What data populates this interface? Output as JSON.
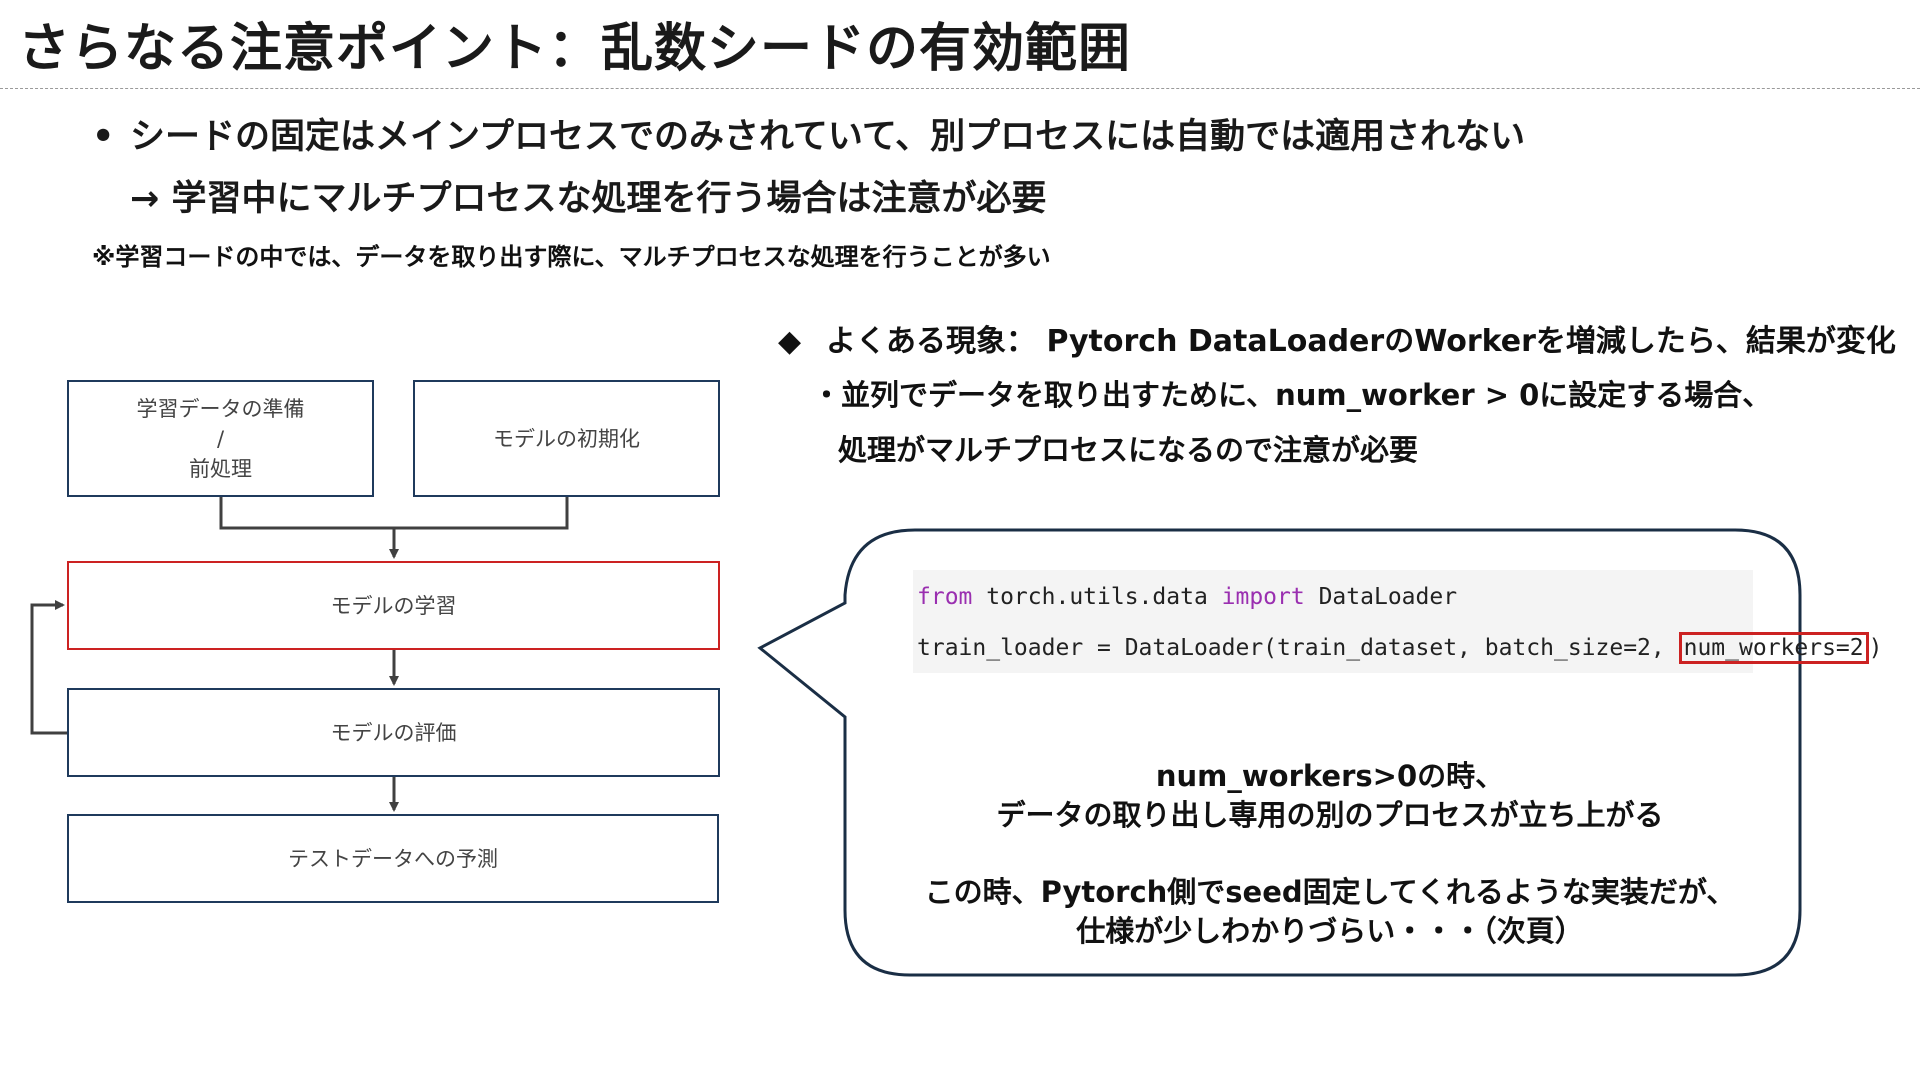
{
  "slide": {
    "title": "さらなる注意ポイント：乱数シードの有効範囲",
    "bullet_marker": "•",
    "bullet_text": "シードの固定はメインプロセスでのみされていて、別プロセスには自動では適用されない",
    "bullet_sub": "→ 学習中にマルチプロセスな処理を行う場合は注意が必要",
    "note": "※学習コードの中では、データを取り出す際に、マルチプロセスな処理を行うことが多い"
  },
  "flowchart": {
    "prep_line1": "学習データの準備",
    "prep_line2": "/",
    "prep_line3": "前処理",
    "init": "モデルの初期化",
    "train": "モデルの学習",
    "eval": "モデルの評価",
    "predict": "テストデータへの予測"
  },
  "right": {
    "diamond": "◆",
    "phenomenon": "よくある現象： Pytorch DataLoaderのWorkerを増減したら、結果が変化",
    "detail_line1": "・並列でデータを取り出すために、num_worker > 0に設定する場合、",
    "detail_line2": "処理がマルチプロセスになるので注意が必要"
  },
  "code": {
    "l1_from": "from",
    "l1_module": " torch.utils.data ",
    "l1_import": "import",
    "l1_name": " DataLoader",
    "l2_main": "train_loader = DataLoader(train_dataset, batch_size=2, ",
    "l2_highlight": "num_workers=2",
    "l2_end": ")"
  },
  "bubble": {
    "line1": "num_workers>0の時、",
    "line2": "データの取り出し専用の別のプロセスが立ち上がる",
    "line3": "この時、Pytorch側でseed固定してくれるような実装だが、",
    "line4": "仕様が少しわかりづらい・・・（次頁）"
  },
  "colors": {
    "box_border": "#1f3a5c",
    "highlight_border": "#cc2222",
    "keyword": "#9a2fb0",
    "arrow": "#404040"
  }
}
